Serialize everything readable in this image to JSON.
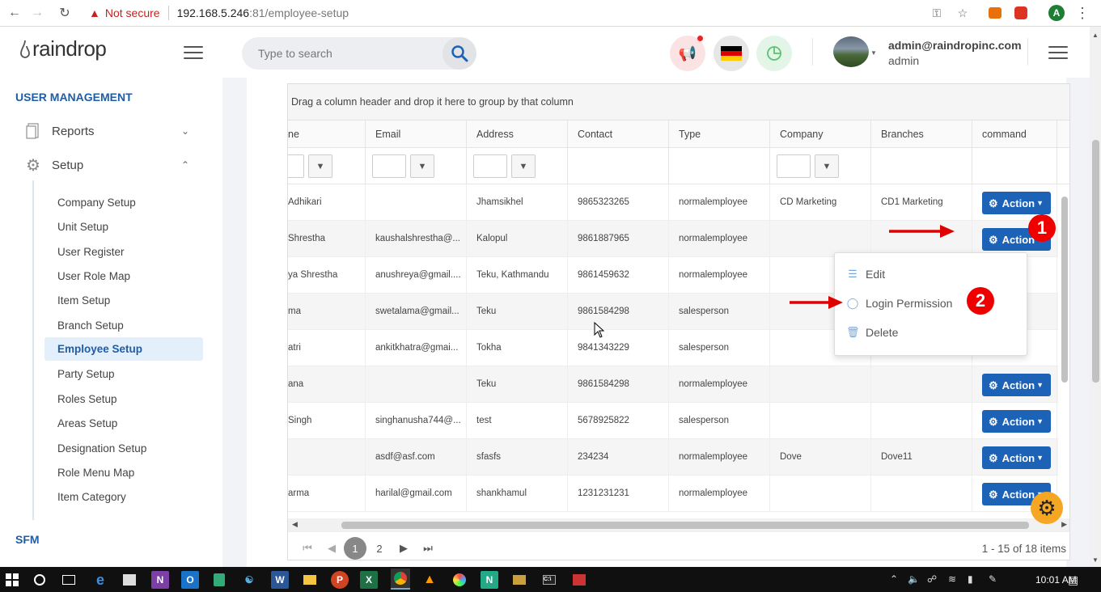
{
  "browser": {
    "security_label": "Not secure",
    "url_host": "192.168.5.246",
    "url_path": ":81/employee-setup",
    "profile_initial": "A"
  },
  "header": {
    "logo_text": "raindrop",
    "search_placeholder": "Type to search",
    "user_email": "admin@raindropinc.com",
    "user_role": "admin"
  },
  "sidebar": {
    "section_user_management": "USER MANAGEMENT",
    "reports_label": "Reports",
    "setup_label": "Setup",
    "items": [
      {
        "label": "Company Setup"
      },
      {
        "label": "Unit Setup"
      },
      {
        "label": "User Register"
      },
      {
        "label": "User Role Map"
      },
      {
        "label": "Item Setup"
      },
      {
        "label": "Branch Setup"
      },
      {
        "label": "Employee Setup"
      },
      {
        "label": "Party Setup"
      },
      {
        "label": "Roles Setup"
      },
      {
        "label": "Areas Setup"
      },
      {
        "label": "Designation Setup"
      },
      {
        "label": "Role Menu Map"
      },
      {
        "label": "Item Category"
      }
    ],
    "section_sfm": "SFM"
  },
  "grid": {
    "group_hint": "Drag a column header and drop it here to group by that column",
    "columns": [
      "ne",
      "Email",
      "Address",
      "Contact",
      "Type",
      "Company",
      "Branches",
      "command"
    ],
    "rows": [
      {
        "name": "Adhikari",
        "email": "",
        "address": "Jhamsikhel",
        "contact": "9865323265",
        "type": "normalemployee",
        "company": "CD Marketing",
        "branches": "CD1 Marketing"
      },
      {
        "name": "Shrestha",
        "email": "kaushalshrestha@...",
        "address": "Kalopul",
        "contact": "9861887965",
        "type": "normalemployee",
        "company": "",
        "branches": ""
      },
      {
        "name": "ya Shrestha",
        "email": "anushreya@gmail....",
        "address": "Teku, Kathmandu",
        "contact": "9861459632",
        "type": "normalemployee",
        "company": "",
        "branches": ""
      },
      {
        "name": "ma",
        "email": "swetalama@gmail...",
        "address": "Teku",
        "contact": "9861584298",
        "type": "salesperson",
        "company": "",
        "branches": ""
      },
      {
        "name": "atri",
        "email": "ankitkhatra@gmai...",
        "address": "Tokha",
        "contact": "9841343229",
        "type": "salesperson",
        "company": "",
        "branches": ""
      },
      {
        "name": "ana",
        "email": "",
        "address": "Teku",
        "contact": "9861584298",
        "type": "normalemployee",
        "company": "",
        "branches": ""
      },
      {
        "name": "Singh",
        "email": "singhanusha744@...",
        "address": "test",
        "contact": "5678925822",
        "type": "salesperson",
        "company": "",
        "branches": ""
      },
      {
        "name": "",
        "email": "asdf@asf.com",
        "address": "sfasfs",
        "contact": "234234",
        "type": "normalemployee",
        "company": "Dove",
        "branches": "Dove11"
      },
      {
        "name": "arma",
        "email": "harilal@gmail.com",
        "address": "shankhamul",
        "contact": "1231231231",
        "type": "normalemployee",
        "company": "",
        "branches": ""
      }
    ],
    "action_label": "Action",
    "pager": {
      "pages": [
        "1",
        "2"
      ],
      "summary": "1 - 15 of 18 items"
    }
  },
  "dropdown": {
    "items": [
      "Edit",
      "Login Permission",
      "Delete"
    ]
  },
  "annotations": {
    "badge1": "1",
    "badge2": "2",
    "arrow_color": "#e00000"
  },
  "taskbar": {
    "time": "10:01 AM"
  },
  "colors": {
    "accent": "#1c63b8",
    "sidebar_title": "#1e5da8",
    "fab": "#f5a623"
  }
}
